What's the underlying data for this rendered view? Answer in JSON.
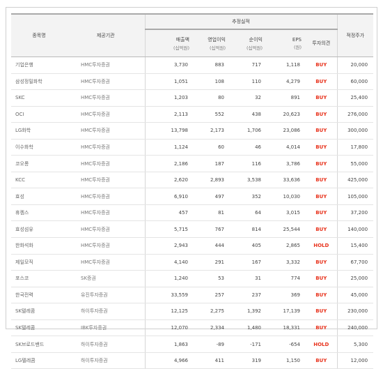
{
  "columns": {
    "name": "종목명",
    "provider": "제공기관",
    "group": "추정실적",
    "revenue": "매출액",
    "revenue_unit": "(십억원)",
    "op_profit": "영업이익",
    "op_profit_unit": "(십억원)",
    "net_profit": "순이익",
    "net_profit_unit": "(십억원)",
    "eps": "EPS",
    "eps_unit": "(원)",
    "opinion": "투자의견",
    "target": "적정주가"
  },
  "colors": {
    "buy": "#e8331d",
    "hold": "#e8331d",
    "header_bg": "#f3f3f3"
  },
  "rows": [
    {
      "name": "기업은행",
      "provider": "HMC투자증권",
      "revenue": "3,730",
      "op": "883",
      "net": "717",
      "eps": "1,118",
      "opinion": "BUY",
      "target": "20,000"
    },
    {
      "name": "삼성정밀화학",
      "provider": "HMC투자증권",
      "revenue": "1,051",
      "op": "108",
      "net": "110",
      "eps": "4,279",
      "opinion": "BUY",
      "target": "60,000"
    },
    {
      "name": "SKC",
      "provider": "HMC투자증권",
      "revenue": "1,203",
      "op": "80",
      "net": "32",
      "eps": "891",
      "opinion": "BUY",
      "target": "25,400"
    },
    {
      "name": "OCI",
      "provider": "HMC투자증권",
      "revenue": "2,113",
      "op": "552",
      "net": "438",
      "eps": "20,623",
      "opinion": "BUY",
      "target": "276,000"
    },
    {
      "name": "LG화학",
      "provider": "HMC투자증권",
      "revenue": "13,798",
      "op": "2,173",
      "net": "1,706",
      "eps": "23,086",
      "opinion": "BUY",
      "target": "300,000"
    },
    {
      "name": "이수화학",
      "provider": "HMC투자증권",
      "revenue": "1,124",
      "op": "60",
      "net": "46",
      "eps": "4,014",
      "opinion": "BUY",
      "target": "17,800"
    },
    {
      "name": "코오롱",
      "provider": "HMC투자증권",
      "revenue": "2,186",
      "op": "187",
      "net": "116",
      "eps": "3,786",
      "opinion": "BUY",
      "target": "55,000"
    },
    {
      "name": "KCC",
      "provider": "HMC투자증권",
      "revenue": "2,620",
      "op": "2,893",
      "net": "3,538",
      "eps": "33,636",
      "opinion": "BUY",
      "target": "425,000"
    },
    {
      "name": "효성",
      "provider": "HMC투자증권",
      "revenue": "6,910",
      "op": "497",
      "net": "352",
      "eps": "10,030",
      "opinion": "BUY",
      "target": "105,000"
    },
    {
      "name": "휴켐스",
      "provider": "HMC투자증권",
      "revenue": "457",
      "op": "81",
      "net": "64",
      "eps": "3,015",
      "opinion": "BUY",
      "target": "37,200"
    },
    {
      "name": "효성섬유",
      "provider": "HMC투자증권",
      "revenue": "5,715",
      "op": "767",
      "net": "814",
      "eps": "25,544",
      "opinion": "BUY",
      "target": "140,000"
    },
    {
      "name": "한화석화",
      "provider": "HMC투자증권",
      "revenue": "2,943",
      "op": "444",
      "net": "405",
      "eps": "2,865",
      "opinion": "HOLD",
      "target": "15,400"
    },
    {
      "name": "제일모직",
      "provider": "HMC투자증권",
      "revenue": "4,140",
      "op": "291",
      "net": "167",
      "eps": "3,332",
      "opinion": "BUY",
      "target": "67,700"
    },
    {
      "name": "포스코",
      "provider": "SK증권",
      "revenue": "1,240",
      "op": "53",
      "net": "31",
      "eps": "774",
      "opinion": "BUY",
      "target": "25,000"
    },
    {
      "name": "한국전력",
      "provider": "유진투자증권",
      "revenue": "33,559",
      "op": "257",
      "net": "237",
      "eps": "369",
      "opinion": "BUY",
      "target": "45,000"
    },
    {
      "name": "SK텔레콤",
      "provider": "하이투자증권",
      "revenue": "12,125",
      "op": "2,275",
      "net": "1,392",
      "eps": "17,139",
      "opinion": "BUY",
      "target": "230,000"
    },
    {
      "name": "SK텔레콤",
      "provider": "IBK투자증권",
      "revenue": "12,070",
      "op": "2,334",
      "net": "1,480",
      "eps": "18,331",
      "opinion": "BUY",
      "target": "240,000"
    },
    {
      "name": "SK브로드밴드",
      "provider": "하이투자증권",
      "revenue": "1,863",
      "op": "-89",
      "net": "-171",
      "eps": "-654",
      "opinion": "HOLD",
      "target": "5,300"
    },
    {
      "name": "LG텔레콤",
      "provider": "하이투자증권",
      "revenue": "4,966",
      "op": "411",
      "net": "319",
      "eps": "1,150",
      "opinion": "BUY",
      "target": "12,000"
    }
  ]
}
